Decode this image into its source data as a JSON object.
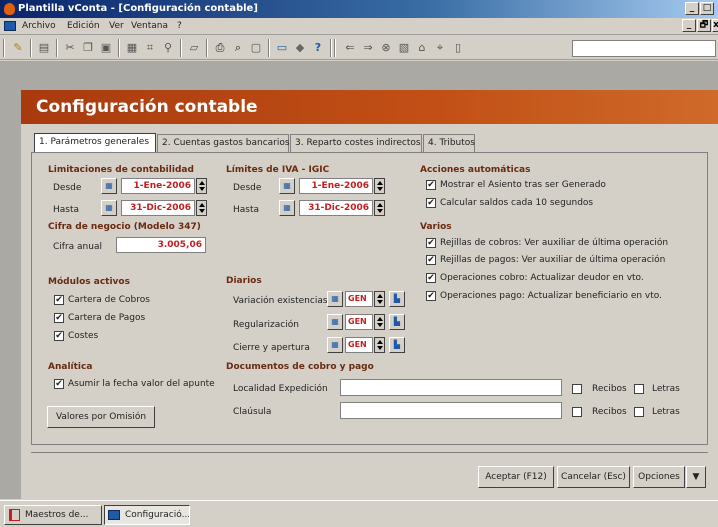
{
  "window": {
    "title": "Plantilla vConta - [Configuración contable]",
    "min": "_",
    "max": "□",
    "close": "x"
  },
  "menu": {
    "items": [
      "Archivo",
      "Edición",
      "Ver",
      "Ventana",
      "?"
    ],
    "mdi_min": "_",
    "mdi_restore": "🗗",
    "mdi_close": "x"
  },
  "toolbar": {
    "icons": [
      "open-icon",
      "properties-icon",
      "cut-icon",
      "copy-icon",
      "paste-icon",
      "grid-icon",
      "tree-icon",
      "zoom-icon",
      "folder-icon",
      "print-icon",
      "preview-icon",
      "page-icon",
      "window-icon",
      "diamond-icon",
      "help-icon",
      "back-icon",
      "forward-icon",
      "stop-icon",
      "refresh-icon",
      "home-icon",
      "search-icon",
      "blank-icon"
    ],
    "search_value": ""
  },
  "form": {
    "title": "Configuración contable",
    "tabs": [
      "1. Parámetros generales",
      "2. Cuentas gastos bancarios",
      "3. Reparto costes indirectos",
      "4. Tributos"
    ],
    "limitaciones": {
      "heading": "Limitaciones de contabilidad",
      "desde_label": "Desde",
      "desde_value": "1-Ene-2006",
      "hasta_label": "Hasta",
      "hasta_value": "31-Dic-2006"
    },
    "iva": {
      "heading": "Límites de IVA - IGIC",
      "desde_label": "Desde",
      "desde_value": "1-Ene-2006",
      "hasta_label": "Hasta",
      "hasta_value": "31-Dic-2006"
    },
    "cifra": {
      "heading": "Cifra de negocio (Modelo 347)",
      "label": "Cifra anual",
      "value": "3.005,06"
    },
    "modulos": {
      "heading": "Módulos activos",
      "items": [
        "Cartera de Cobros",
        "Cartera de Pagos",
        "Costes"
      ]
    },
    "analitica": {
      "heading": "Analítica",
      "checkbox": "Asumir la fecha valor del apunte"
    },
    "defaults_button": "Valores por Omisión",
    "diarios": {
      "heading": "Diarios",
      "rows": [
        {
          "label": "Variación existencias",
          "value": "GEN"
        },
        {
          "label": "Regularización",
          "value": "GEN"
        },
        {
          "label": "Cierre y apertura",
          "value": "GEN"
        }
      ]
    },
    "acciones": {
      "heading": "Acciones automáticas",
      "items": [
        "Mostrar el Asiento tras ser Generado",
        "Calcular saldos cada 10 segundos"
      ]
    },
    "varios": {
      "heading": "Varios",
      "items": [
        "Rejillas de cobros: Ver auxiliar de última operación",
        "Rejillas de pagos: Ver auxiliar de última operación",
        "Operaciones cobro: Actualizar deudor en vto.",
        "Operaciones pago: Actualizar beneficiario en vto."
      ]
    },
    "documentos": {
      "heading": "Documentos de cobro y pago",
      "rows": [
        {
          "label": "Localidad Expedición",
          "value": "",
          "recibos": "Recibos",
          "letras": "Letras"
        },
        {
          "label": "Claúsula",
          "value": "",
          "recibos": "Recibos",
          "letras": "Letras"
        }
      ]
    },
    "buttons": {
      "accept": "Aceptar (F12)",
      "cancel": "Cancelar (Esc)",
      "options": "Opciones"
    }
  },
  "taskbar": {
    "items": [
      "Maestros de...",
      "Configuració..."
    ]
  },
  "colors": {
    "banner": "#c25016",
    "title": "#0a246a",
    "value_red": "#c02020"
  }
}
